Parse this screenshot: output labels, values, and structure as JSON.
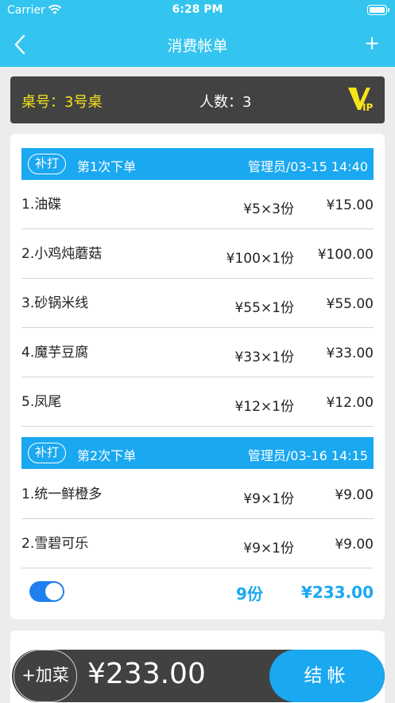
{
  "status_bar": {
    "carrier": "Carrier",
    "time": "6:28 PM"
  },
  "nav": {
    "title": "消费帐单",
    "add": "+"
  },
  "table_info": {
    "table_no": "桌号：3号桌",
    "people": "人数：3",
    "vip_badge": "VIP"
  },
  "orders": [
    {
      "reprint": "补打",
      "title": "第1次下单",
      "meta": "管理员/03-15 14:40",
      "items": [
        {
          "name": "1.油碟",
          "qty": "¥5×3份",
          "amount": "¥15.00"
        },
        {
          "name": "2.小鸡炖蘑菇",
          "qty": "¥100×1份",
          "amount": "¥100.00"
        },
        {
          "name": "3.砂锅米线",
          "qty": "¥55×1份",
          "amount": "¥55.00"
        },
        {
          "name": "4.魔芋豆腐",
          "qty": "¥33×1份",
          "amount": "¥33.00"
        },
        {
          "name": "5.凤尾",
          "qty": "¥12×1份",
          "amount": "¥12.00"
        }
      ]
    },
    {
      "reprint": "补打",
      "title": "第2次下单",
      "meta": "管理员/03-16 14:15",
      "items": [
        {
          "name": "1.统一鲜橙多",
          "qty": "¥9×1份",
          "amount": "¥9.00"
        },
        {
          "name": "2.雪碧可乐",
          "qty": "¥9×1份",
          "amount": "¥9.00"
        }
      ]
    }
  ],
  "summary": {
    "count": "9份",
    "total": "¥233.00",
    "toggle_on": true
  },
  "bottom": {
    "add_label": "+加菜",
    "total": "¥233.00",
    "checkout_label": "结帐"
  },
  "colors": {
    "accent": "#33c4ef",
    "header_blue": "#1aa8f0",
    "dark_bar": "#424242",
    "table_yellow": "#f7e31a",
    "toggle_blue": "#1e7ff0"
  }
}
